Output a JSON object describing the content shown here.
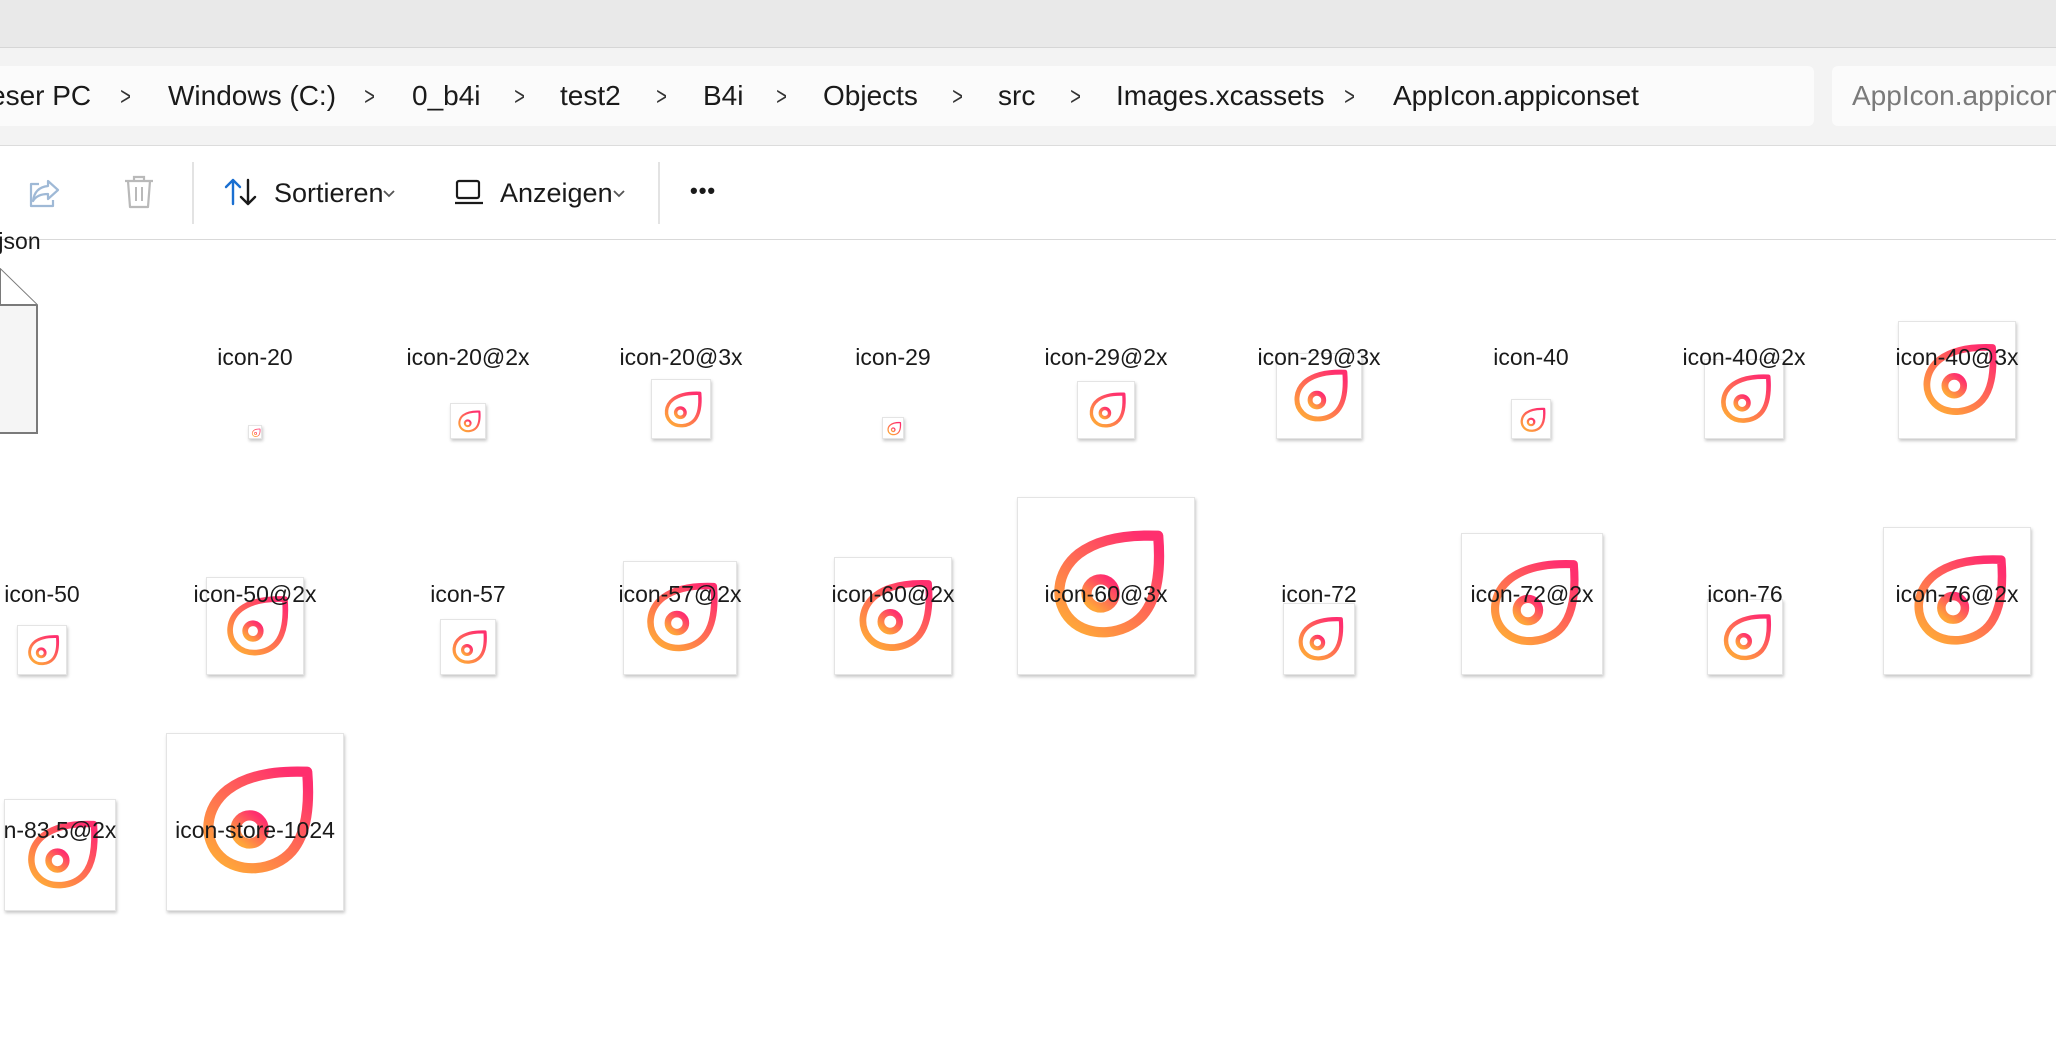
{
  "titlebar": {},
  "breadcrumb": {
    "items": [
      "eser PC",
      "Windows (C:)",
      "0_b4i",
      "test2",
      "B4i",
      "Objects",
      "src",
      "Images.xcassets",
      "AppIcon.appiconset"
    ],
    "separator": ">"
  },
  "search": {
    "placeholder": "AppIcon.appiconset durchsuchen"
  },
  "toolbar": {
    "share_icon": "share-icon",
    "delete_icon": "trash-icon",
    "sort_label": "Sortieren",
    "view_label": "Anzeigen",
    "more_label": "•••"
  },
  "files": [
    {
      "name": "ntents.json",
      "type": "json"
    },
    {
      "name": "icon-20",
      "type": "image"
    },
    {
      "name": "icon-20@2x",
      "type": "image"
    },
    {
      "name": "icon-20@3x",
      "type": "image"
    },
    {
      "name": "icon-29",
      "type": "image"
    },
    {
      "name": "icon-29@2x",
      "type": "image"
    },
    {
      "name": "icon-29@3x",
      "type": "image"
    },
    {
      "name": "icon-40",
      "type": "image"
    },
    {
      "name": "icon-40@2x",
      "type": "image"
    },
    {
      "name": "icon-40@3x",
      "type": "image"
    },
    {
      "name": "icon-50",
      "type": "image"
    },
    {
      "name": "icon-50@2x",
      "type": "image"
    },
    {
      "name": "icon-57",
      "type": "image"
    },
    {
      "name": "icon-57@2x",
      "type": "image"
    },
    {
      "name": "icon-60@2x",
      "type": "image"
    },
    {
      "name": "icon-60@3x",
      "type": "image"
    },
    {
      "name": "icon-72",
      "type": "image"
    },
    {
      "name": "icon-72@2x",
      "type": "image"
    },
    {
      "name": "icon-76",
      "type": "image"
    },
    {
      "name": "icon-76@2x",
      "type": "image"
    },
    {
      "name": "n-83.5@2x",
      "type": "image"
    },
    {
      "name": "icon-store-1024",
      "type": "image"
    }
  ],
  "colors": {
    "icon_gradient_start": "#ff2f6e",
    "icon_gradient_end": "#ffa53a",
    "sort_arrow": "#1a6fd1",
    "toolbar_disabled": "#9fb9d6"
  }
}
